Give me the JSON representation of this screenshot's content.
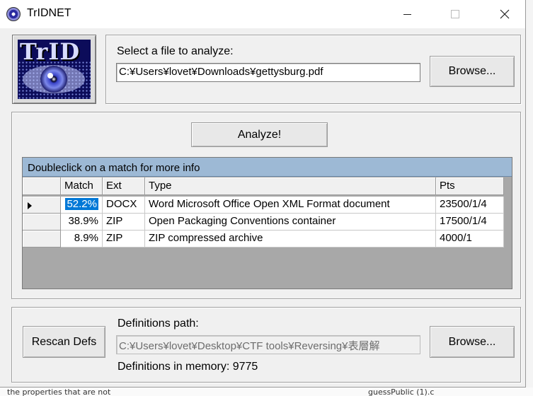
{
  "window": {
    "title": "TrIDNET",
    "icon": "trid-eye-icon"
  },
  "logo": {
    "text": "TrID"
  },
  "analyze_section": {
    "label": "Select a file to analyze:",
    "file_path": "C:¥Users¥lovet¥Downloads¥gettysburg.pdf",
    "browse_label": "Browse...",
    "analyze_label": "Analyze!"
  },
  "results": {
    "caption": "Doubleclick on a match for more info",
    "columns": {
      "match": "Match",
      "ext": "Ext",
      "type": "Type",
      "pts": "Pts"
    },
    "rows": [
      {
        "match": "52.2%",
        "ext": "DOCX",
        "type": "Word Microsoft Office Open XML Format document",
        "pts": "23500/1/4"
      },
      {
        "match": "38.9%",
        "ext": "ZIP",
        "type": "Open Packaging Conventions container",
        "pts": "17500/1/4"
      },
      {
        "match": "8.9%",
        "ext": "ZIP",
        "type": "ZIP compressed archive",
        "pts": "4000/1"
      }
    ]
  },
  "definitions": {
    "rescan_label": "Rescan Defs",
    "path_label": "Definitions path:",
    "path_value": "C:¥Users¥lovet¥Desktop¥CTF tools¥Reversing¥表層解",
    "browse_label": "Browse...",
    "memory_text": "Definitions in memory: 9775"
  },
  "background": {
    "fragment_left": "the properties that are not",
    "fragment_right": "guessPublic (1).c"
  },
  "colors": {
    "caption_bar": "#9db9d5",
    "selection": "#0078d7",
    "list_empty": "#a8a8a8"
  }
}
